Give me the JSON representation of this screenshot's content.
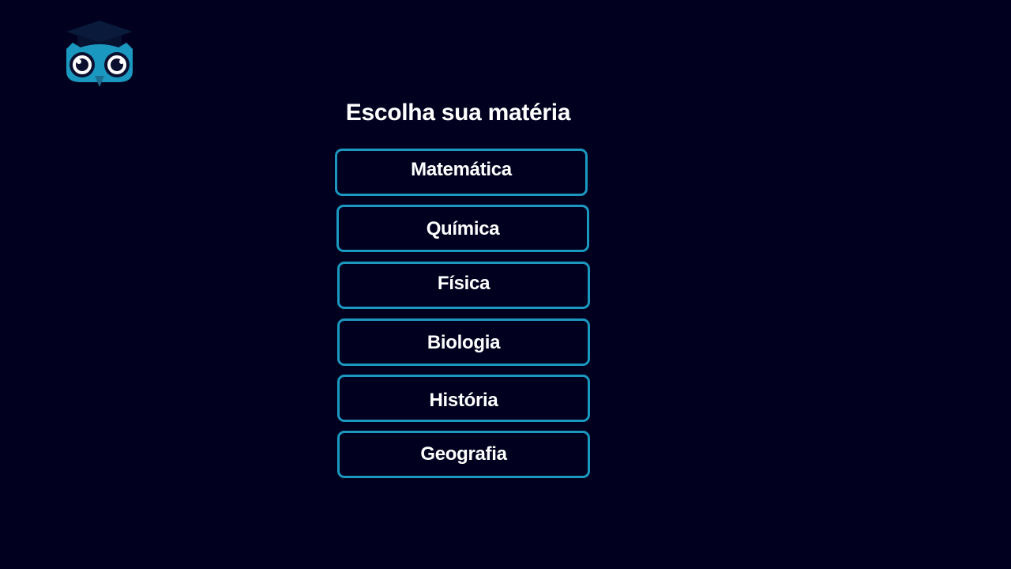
{
  "app": {
    "logo_icon": "owl-graduation-cap-icon"
  },
  "header": {
    "title": "Escolha sua matéria"
  },
  "subjects": [
    {
      "label": "Matemática"
    },
    {
      "label": "Química"
    },
    {
      "label": "Física"
    },
    {
      "label": "Biologia"
    },
    {
      "label": "História"
    },
    {
      "label": "Geografia"
    }
  ],
  "colors": {
    "background": "#01011f",
    "button_border": "#1b98c0",
    "text": "#ffffff",
    "owl_blue": "#1b98c0"
  }
}
